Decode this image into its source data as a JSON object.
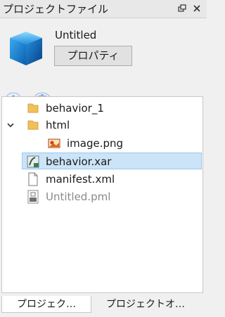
{
  "panel": {
    "title": "プロジェクトファイル"
  },
  "project": {
    "name": "Untitled",
    "properties_label": "プロパティ"
  },
  "tree": {
    "items": [
      {
        "label": "behavior_1"
      },
      {
        "label": "html"
      },
      {
        "label": "image.png"
      },
      {
        "label": "behavior.xar"
      },
      {
        "label": "manifest.xml"
      },
      {
        "label": "Untitled.pml"
      }
    ]
  },
  "tabs": [
    {
      "label": "プロジェク…"
    },
    {
      "label": "プロジェクトオ…"
    }
  ],
  "colors": {
    "selection": "#cce4f7",
    "folder": "#f0c05a",
    "add": "#1e6fd9",
    "cube": "#39a7e6"
  }
}
